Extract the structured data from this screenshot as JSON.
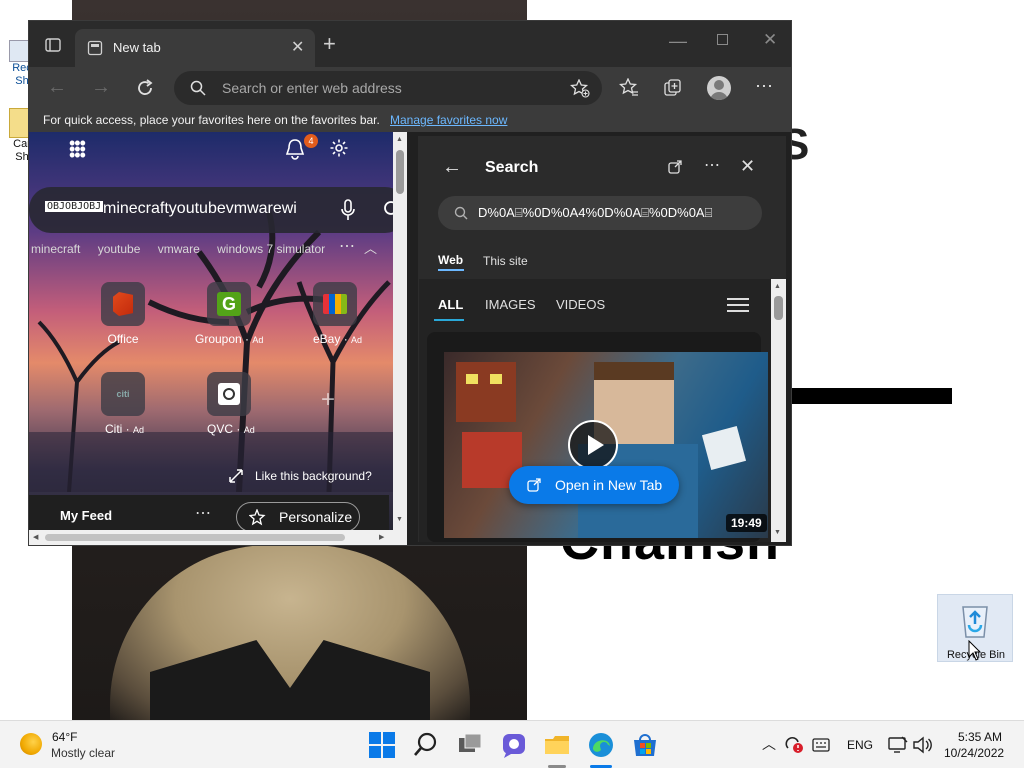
{
  "browser": {
    "tab_title": "New tab",
    "address_placeholder": "Search or enter web address",
    "favbar_text": "For quick access, place your favorites here on the favorites bar.",
    "favbar_link": "Manage favorites now",
    "notification_count": "4"
  },
  "ntp": {
    "search_value": "minecraftyoutubevmwarewi",
    "search_prefix": "OBJOBJOBJ",
    "suggestions": [
      "minecraft",
      "youtube",
      "vmware",
      "windows 7 simulator"
    ],
    "tiles": [
      {
        "label": "Office",
        "ad": ""
      },
      {
        "label": "Groupon",
        "ad": "Ad"
      },
      {
        "label": "eBay",
        "ad": "Ad"
      },
      {
        "label": "Citi",
        "ad": "Ad"
      },
      {
        "label": "QVC",
        "ad": "Ad"
      }
    ],
    "like_bg": "Like this background?",
    "my_feed": "My Feed",
    "personalize": "Personalize"
  },
  "side_panel": {
    "title": "Search",
    "query": "D%0A⌸%0D%0A4%0D%0A⌸%0D%0A⌸",
    "tabs": [
      "Web",
      "This site"
    ],
    "filters": [
      "ALL",
      "IMAGES",
      "VIDEOS"
    ],
    "open_new_tab": "Open in New Tab",
    "duration": "19:49"
  },
  "desktop": {
    "recycle_bin": "Recycle Bin",
    "wall_text": "Chainsh",
    "left_icon_1": "Rec\nSh",
    "left_icon_2": "Car\nSh"
  },
  "taskbar": {
    "weather_temp": "64°F",
    "weather_desc": "Mostly clear",
    "language": "ENG",
    "time": "5:35 AM",
    "date": "10/24/2022"
  },
  "colors": {
    "accent": "#0a7ae8",
    "link": "#6cb8ff",
    "badge": "#e25c1c"
  }
}
